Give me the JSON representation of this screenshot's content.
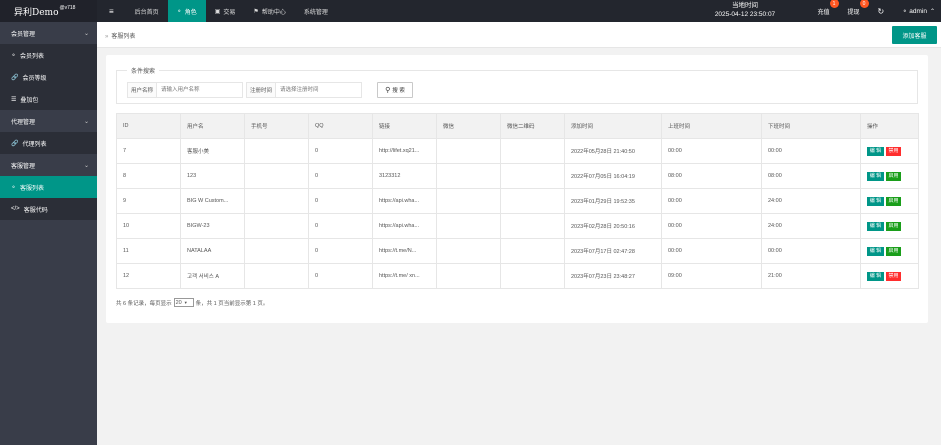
{
  "app": {
    "name": "异利Demo",
    "version": "@v718"
  },
  "topnav": {
    "menu_icon": "≡",
    "items": [
      {
        "label": "后台首页",
        "icon": "",
        "active": false
      },
      {
        "label": "角色",
        "icon": "person-icon",
        "active": true
      },
      {
        "label": "交易",
        "icon": "gamepad-icon",
        "active": false
      },
      {
        "label": "帮助中心",
        "icon": "flag-icon",
        "active": false
      },
      {
        "label": "系统管理",
        "icon": "",
        "active": false
      }
    ]
  },
  "datetime": {
    "label": "当地时间",
    "value": "2025-04-12 23:50:07"
  },
  "topright": {
    "recharge": {
      "label": "充值",
      "badge": "1"
    },
    "withdraw": {
      "label": "提现",
      "badge": "0"
    },
    "refresh_icon": "refresh-icon",
    "user": "admin"
  },
  "sidebar": [
    {
      "type": "group",
      "label": "会员管理"
    },
    {
      "type": "item",
      "label": "会员列表",
      "icon": "person-icon",
      "active": false
    },
    {
      "type": "item",
      "label": "会员等级",
      "icon": "link-icon",
      "active": false
    },
    {
      "type": "item",
      "label": "叠加包",
      "icon": "list-icon",
      "active": false
    },
    {
      "type": "group",
      "label": "代理管理"
    },
    {
      "type": "item",
      "label": "代理列表",
      "icon": "link-icon",
      "active": false
    },
    {
      "type": "group",
      "label": "客服管理"
    },
    {
      "type": "item",
      "label": "客服列表",
      "icon": "users-icon",
      "active": true
    },
    {
      "type": "item",
      "label": "客服代码",
      "icon": "code-icon",
      "active": false
    }
  ],
  "breadcrumb": {
    "label": "客服列表"
  },
  "add_button": "添加客服",
  "search": {
    "legend": "条件搜索",
    "username_label": "用户名称",
    "username_placeholder": "请输入用户名称",
    "regtime_label": "注册时间",
    "regtime_placeholder": "请选择注册时间",
    "button": "搜 索"
  },
  "table": {
    "columns": [
      "ID",
      "用户名",
      "手机号",
      "QQ",
      "链接",
      "微信",
      "微信二维码",
      "添加时间",
      "上班时间",
      "下班时间",
      "操作"
    ],
    "rows": [
      {
        "id": "7",
        "username": "客服小美",
        "phone": "",
        "qq": "0",
        "link": "http://lifet.xq21...",
        "wechat": "",
        "qrcode": "",
        "added": "2022年05月28日 21:40:50",
        "start": "00:00",
        "end": "00:00",
        "edit": "编 辑",
        "toggle": "禁用",
        "toggle_state": "off"
      },
      {
        "id": "8",
        "username": "123",
        "phone": "",
        "qq": "0",
        "link": "3123312",
        "wechat": "",
        "qrcode": "",
        "added": "2022年07月05日 16:04:19",
        "start": "08:00",
        "end": "08:00",
        "edit": "编 辑",
        "toggle": "启用",
        "toggle_state": "on"
      },
      {
        "id": "9",
        "username": "BIG W Custom...",
        "phone": "",
        "qq": "0",
        "link": "https://api.wha...",
        "wechat": "",
        "qrcode": "",
        "added": "2023年01月29日 19:52:35",
        "start": "00:00",
        "end": "24:00",
        "edit": "编 辑",
        "toggle": "启用",
        "toggle_state": "on"
      },
      {
        "id": "10",
        "username": "BIGW-23",
        "phone": "",
        "qq": "0",
        "link": "https://api.wha...",
        "wechat": "",
        "qrcode": "",
        "added": "2023年02月28日 20:50:16",
        "start": "00:00",
        "end": "24:00",
        "edit": "编 辑",
        "toggle": "启用",
        "toggle_state": "on"
      },
      {
        "id": "11",
        "username": "NATALAA",
        "phone": "",
        "qq": "0",
        "link": "https://t.me/N...",
        "wechat": "",
        "qrcode": "",
        "added": "2023年07月17日 02:47:28",
        "start": "00:00",
        "end": "00:00",
        "edit": "编 辑",
        "toggle": "启用",
        "toggle_state": "on"
      },
      {
        "id": "12",
        "username": "고객 서비스 A",
        "phone": "",
        "qq": "0",
        "link": "https://t.me/ xn...",
        "wechat": "",
        "qrcode": "",
        "added": "2023年07月23日 23:48:27",
        "start": "09:00",
        "end": "21:00",
        "edit": "编 辑",
        "toggle": "禁用",
        "toggle_state": "off"
      }
    ]
  },
  "pager": {
    "prefix": "共 6 条记录，每页显示",
    "per_page": "20",
    "suffix": "条，共 1 页当前显示第 1 页。"
  }
}
